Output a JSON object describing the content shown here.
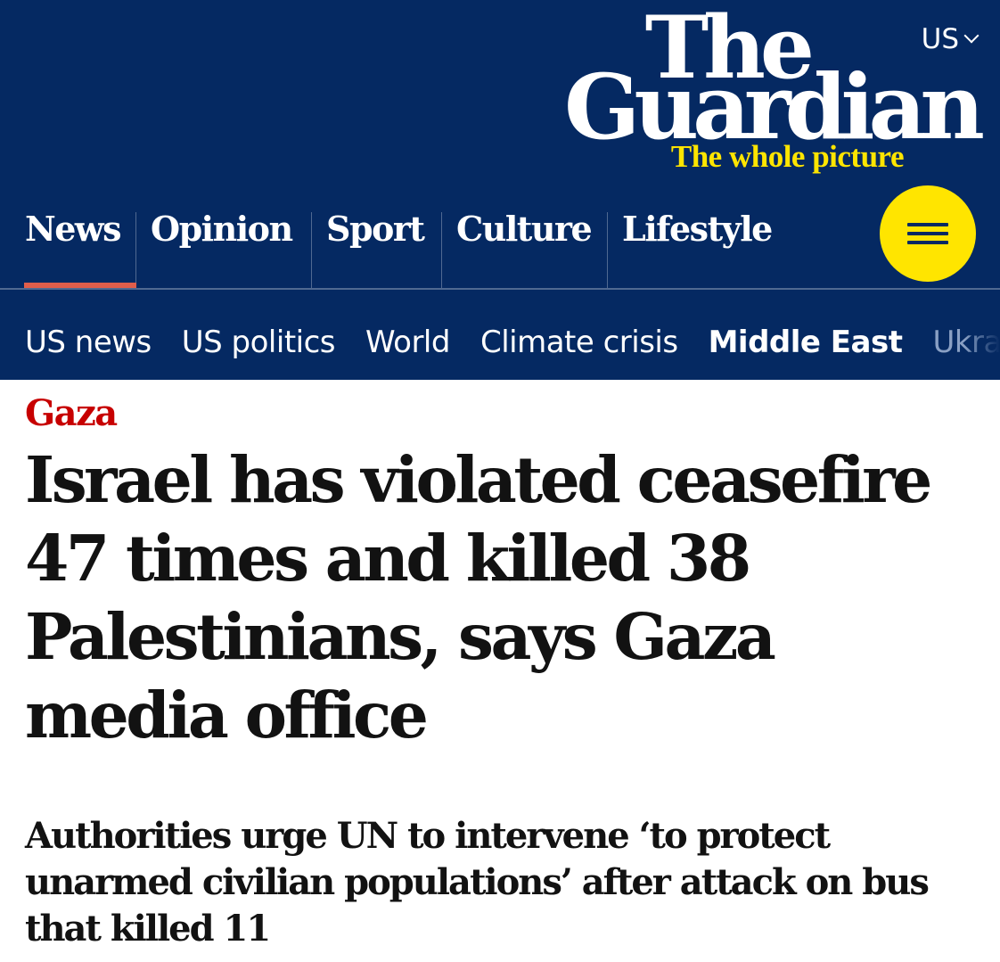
{
  "header": {
    "edition": "US",
    "logo_line1": "The",
    "logo_line2": "Guardian",
    "tagline": "The whole picture",
    "colors": {
      "brand": "#052962",
      "accent": "#ffe500",
      "active": "#e05e4b"
    },
    "pillars": [
      {
        "label": "News",
        "active": true
      },
      {
        "label": "Opinion"
      },
      {
        "label": "Sport"
      },
      {
        "label": "Culture"
      },
      {
        "label": "Lifestyle"
      }
    ],
    "menu_icon": "hamburger-menu-icon",
    "subnav": [
      {
        "label": "US news"
      },
      {
        "label": "US politics"
      },
      {
        "label": "World"
      },
      {
        "label": "Climate crisis"
      },
      {
        "label": "Middle East",
        "active": true
      },
      {
        "label": "Ukra"
      }
    ]
  },
  "article": {
    "kicker": "Gaza",
    "kicker_color": "#c70000",
    "headline": "Israel has violated ceasefire 47 times and killed 38 Palestinians, says Gaza media office",
    "standfirst": "Authorities urge UN to intervene ‘to protect unarmed civilian populations’ after attack on bus that killed 11"
  }
}
